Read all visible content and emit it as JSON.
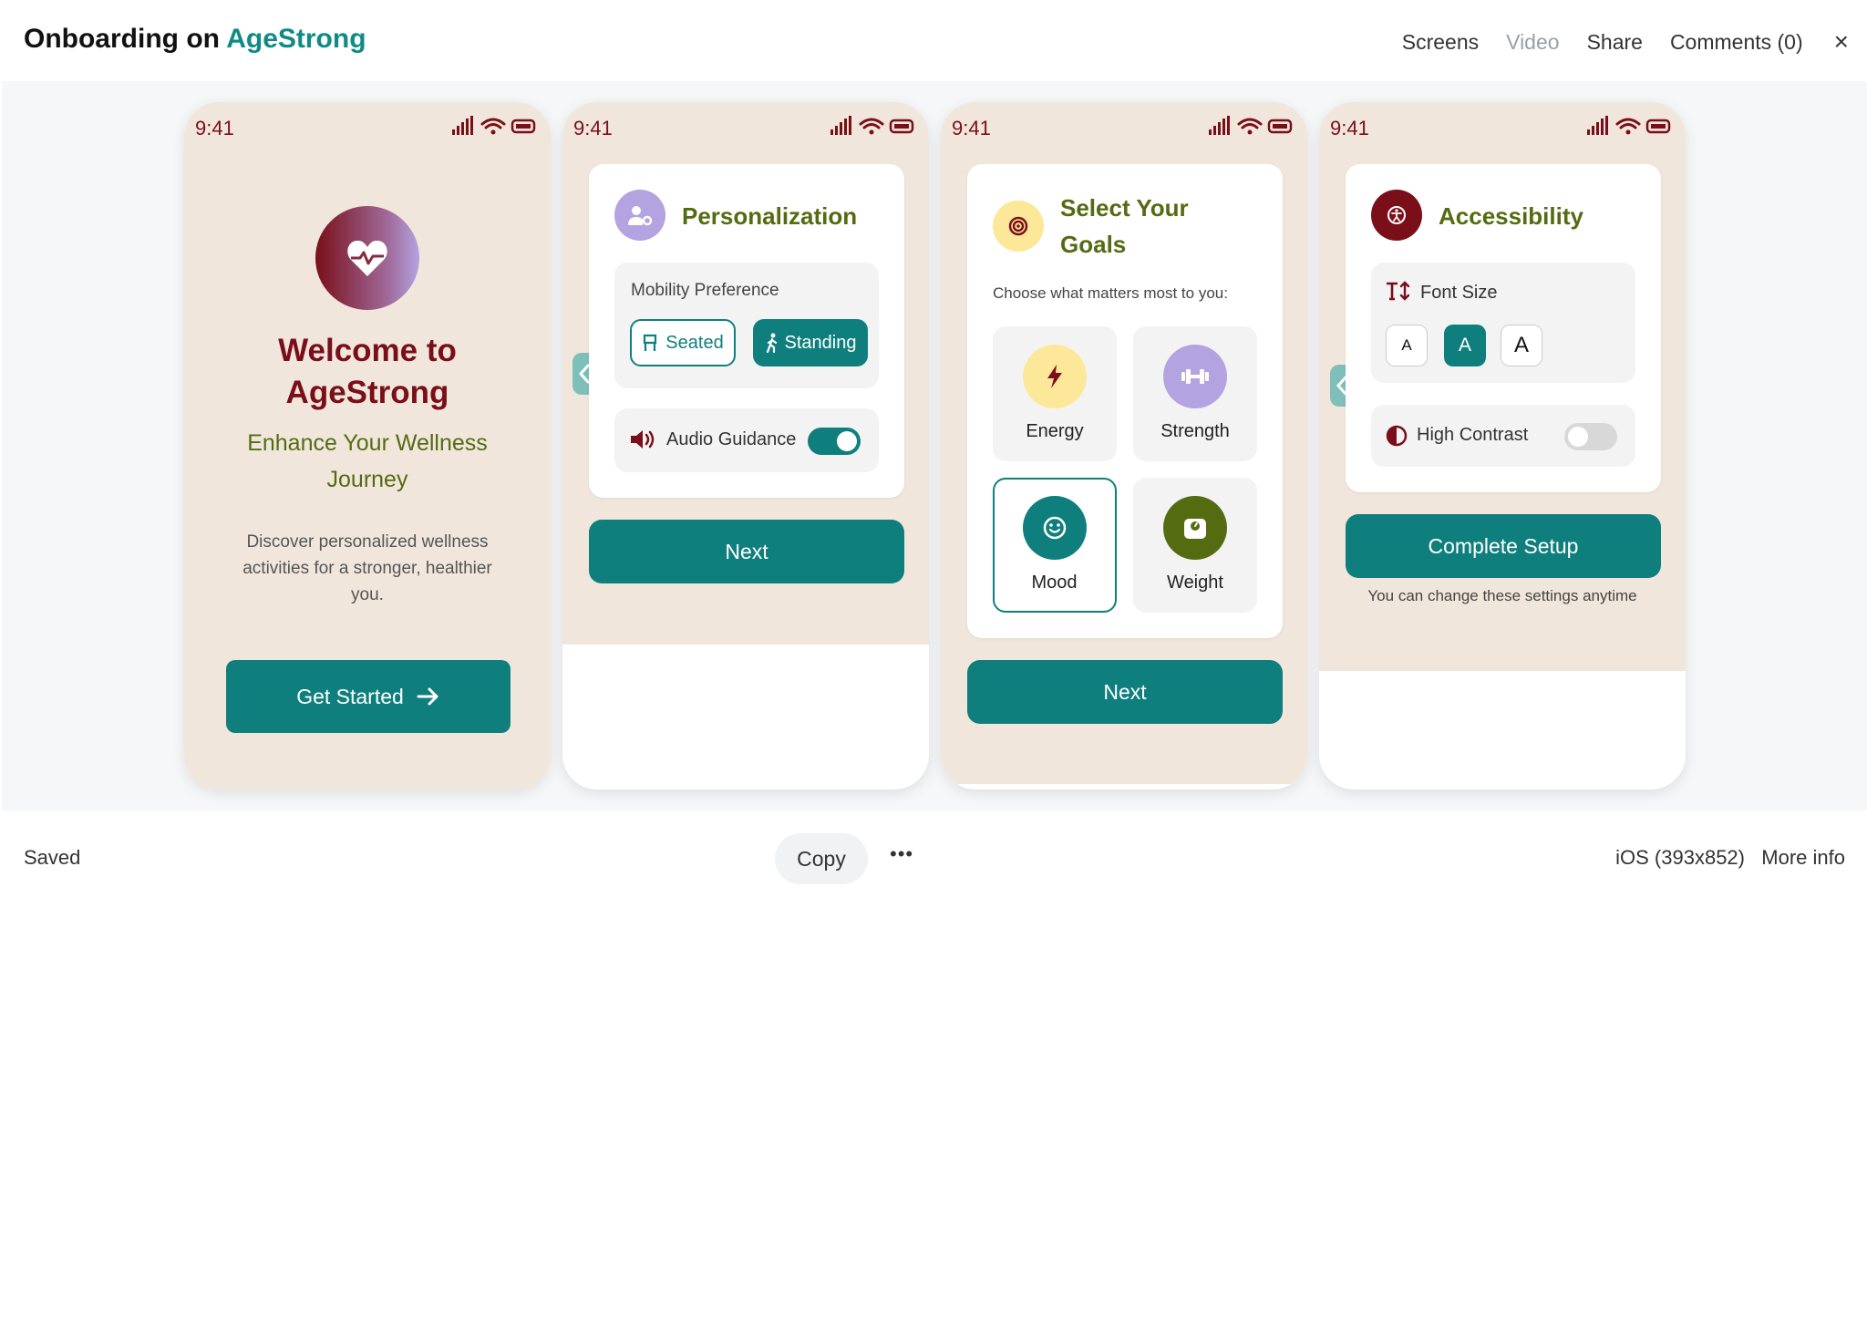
{
  "header": {
    "title_prefix": "Onboarding on",
    "title_brand": "AgeStrong",
    "nav": {
      "screens": "Screens",
      "video": "Video",
      "share": "Share",
      "comments": "Comments (0)",
      "close": "×"
    }
  },
  "status_bar": {
    "time": "9:41"
  },
  "screen1": {
    "heading": "Welcome to AgeStrong",
    "subheading": "Enhance Your Wellness Journey",
    "description": "Discover personalized wellness activities for a stronger, healthier you.",
    "cta": "Get Started"
  },
  "screen2": {
    "title": "Personalization",
    "mobility_label": "Mobility Preference",
    "seated": "Seated",
    "standing": "Standing",
    "audio_label": "Audio Guidance",
    "audio_on": true,
    "next": "Next"
  },
  "screen3": {
    "title": "Select Your Goals",
    "prompt": "Choose what matters most to you:",
    "goals": [
      "Energy",
      "Strength",
      "Mood",
      "Weight"
    ],
    "selected_goal": "Mood",
    "next": "Next"
  },
  "screen4": {
    "title": "Accessibility",
    "font_size_label": "Font Size",
    "font_options": [
      "A",
      "A",
      "A"
    ],
    "selected_font_option": 2,
    "contrast_label": "High Contrast",
    "contrast_on": false,
    "cta": "Complete Setup",
    "note": "You can change these settings anytime"
  },
  "footer": {
    "saved": "Saved",
    "copy": "Copy",
    "more": "•••",
    "device": "iOS (393x852)",
    "more_info": "More info"
  },
  "colors": {
    "teal": "#0f7f7d",
    "maroon": "#7a0f1a",
    "olive": "#556b12",
    "beige": "#f0e6dc",
    "lavender": "#b3a3e0",
    "yellow": "#fde89a"
  }
}
